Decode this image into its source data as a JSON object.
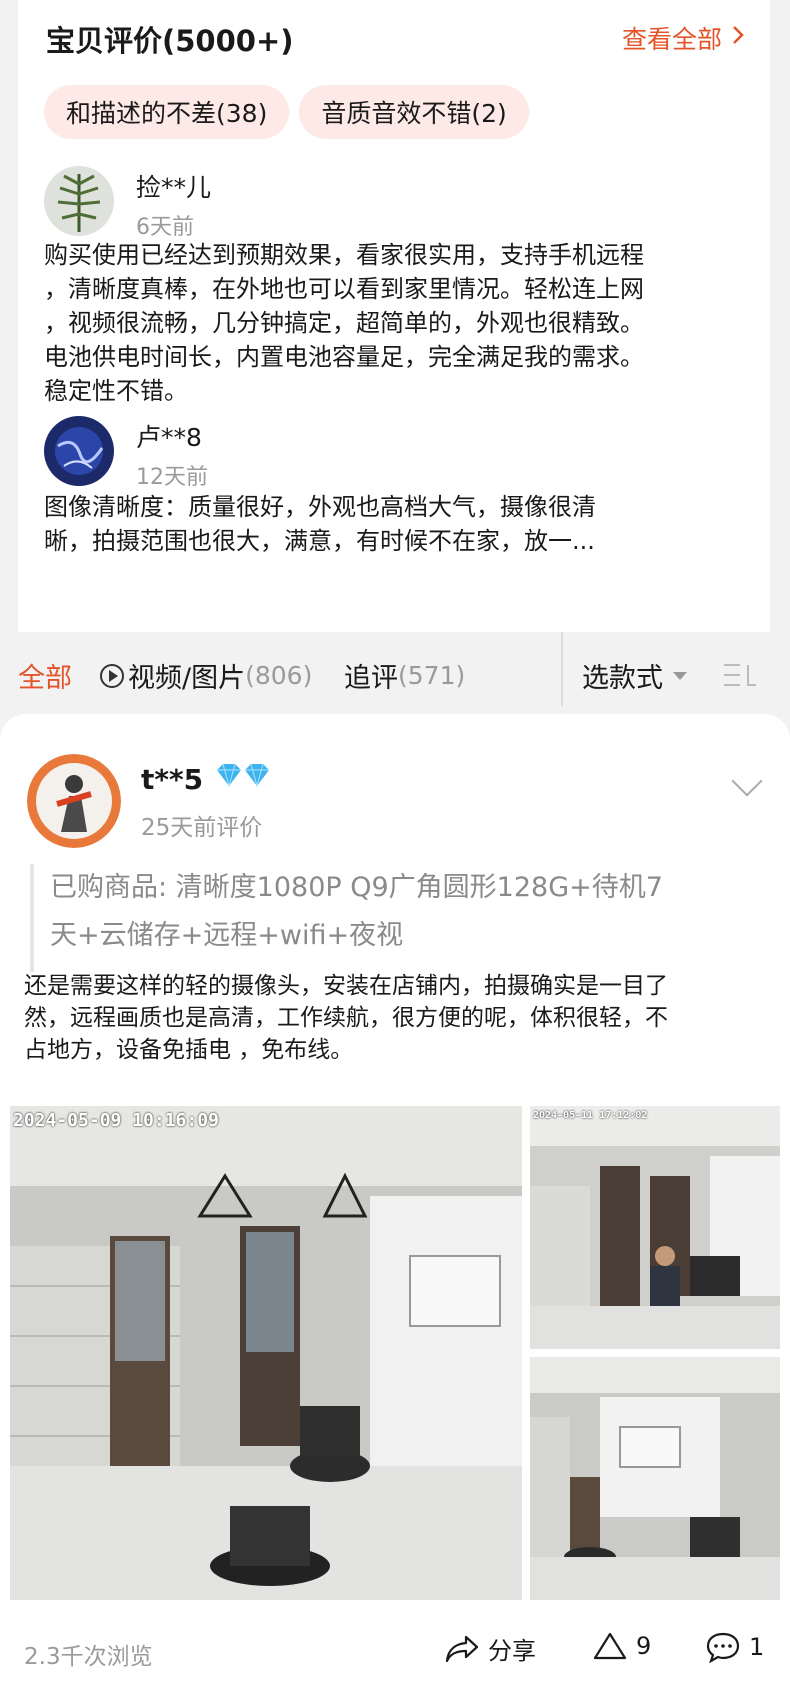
{
  "summary": {
    "title": "宝贝评价(5000+)",
    "view_all": "查看全部",
    "tags": [
      "和描述的不差(38)",
      "音质音效不错(2)"
    ]
  },
  "reviews": [
    {
      "user": "捡**儿",
      "date": "6天前",
      "lines": [
        "购买使用已经达到预期效果，看家很实用，支持手机远程",
        "，清晰度真棒，在外地也可以看到家里情况。轻松连上网",
        "，视频很流畅，几分钟搞定，超简单的，外观也很精致。",
        "电池供电时间长，内置电池容量足，完全满足我的需求。",
        "稳定性不错。"
      ]
    },
    {
      "user": "卢**8",
      "date": "12天前",
      "lines": [
        "图像清晰度：质量很好，外观也高档大气，摄像很清",
        "晰，拍摄范围也很大，满意，有时候不在家，放一..."
      ]
    }
  ],
  "tabs": {
    "all": "全部",
    "video_photo": "视频/图片",
    "video_photo_count": "(806)",
    "follow_up": "追评",
    "follow_up_count": "(571)",
    "select_style": "选款式"
  },
  "main_review": {
    "user": "t**5",
    "date": "25天前评价",
    "purchased_lines": [
      "已购商品: 清晰度1080P  Q9广角圆形128G+待机7",
      " 天+云储存+远程+wifi+夜视"
    ],
    "content_lines": [
      " 还是需要这样的轻的摄像头，安装在店铺内，拍摄确实是一目了",
      "然，远程画质也是高清，工作续航，很方便的呢，体积很轻，不",
      "占地方，设备免插电 ，免布线。"
    ],
    "photos": [
      {
        "timestamp": "2024-05-09  10:16:09"
      },
      {
        "timestamp": "2024-05-11  17:12:02"
      },
      {
        "timestamp": ""
      }
    ],
    "views": "2.3千次浏览",
    "share_label": "分享",
    "like_count": "9",
    "comment_count": "1"
  },
  "colors": {
    "accent": "#e4542a",
    "tag_bg": "#fde9e5",
    "muted": "#9a9a9a"
  },
  "icons": [
    "chevron-right-icon",
    "play-circle-icon",
    "caret-down-icon",
    "menu-icon",
    "diamond-icon",
    "chevron-down-icon",
    "share-icon",
    "like-icon",
    "comment-icon"
  ]
}
